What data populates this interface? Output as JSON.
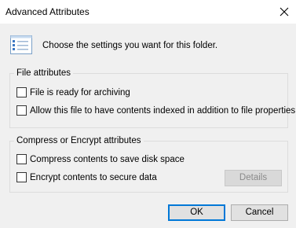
{
  "window": {
    "title": "Advanced Attributes",
    "close_icon": "close-icon"
  },
  "header": {
    "icon": "checklist-icon",
    "text": "Choose the settings you want for this folder."
  },
  "file_attributes": {
    "title": "File attributes",
    "options": [
      {
        "label": "File is ready for archiving",
        "checked": false
      },
      {
        "label": "Allow this file to have contents indexed in addition to file properties",
        "checked": false
      }
    ]
  },
  "compress_encrypt": {
    "title": "Compress or Encrypt attributes",
    "options": [
      {
        "label": "Compress contents to save disk space",
        "checked": false
      },
      {
        "label": "Encrypt contents to secure data",
        "checked": false
      }
    ],
    "details_label": "Details",
    "details_enabled": false
  },
  "buttons": {
    "ok": "OK",
    "cancel": "Cancel"
  },
  "colors": {
    "accent": "#0078d7",
    "dialog_bg": "#f0f0f0"
  }
}
